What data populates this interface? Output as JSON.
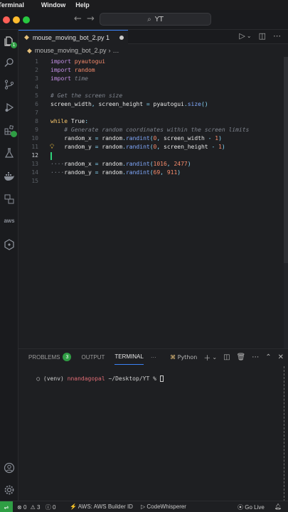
{
  "menubar": {
    "items": [
      "Terminal",
      "Window",
      "Help"
    ]
  },
  "titlebar": {
    "search_text": "YT",
    "search_icon": "search-icon"
  },
  "activity_bar": {
    "icons": [
      "explorer-icon",
      "search-icon",
      "source-control-icon",
      "run-debug-icon",
      "extensions-icon",
      "testing-icon",
      "docker-icon",
      "remote-explorer-icon",
      "aws-icon",
      "codewhisperer-icon",
      "account-icon",
      "settings-icon"
    ],
    "explorer_badge": "1"
  },
  "editor_tab": {
    "label": "mouse_moving_bot_2.py 1"
  },
  "breadcrumb": {
    "file": "mouse_moving_bot_2.py",
    "more": "…"
  },
  "editor": {
    "current_line": "12",
    "lines": [
      {
        "n": "1",
        "parts": [
          [
            "kw",
            "import"
          ],
          [
            "mod",
            " pyautogui"
          ]
        ]
      },
      {
        "n": "2",
        "parts": [
          [
            "kw",
            "import"
          ],
          [
            "mod",
            " random"
          ]
        ]
      },
      {
        "n": "3",
        "parts": [
          [
            "kw",
            "import"
          ],
          [
            "cm",
            " time"
          ]
        ]
      },
      {
        "n": "4",
        "parts": []
      },
      {
        "n": "5",
        "parts": [
          [
            "cm",
            "# Get the screen size"
          ]
        ]
      },
      {
        "n": "6",
        "parts": [
          [
            "vr",
            "screen_width"
          ],
          [
            "op",
            ", "
          ],
          [
            "vr",
            "screen_height"
          ],
          [
            "op",
            " = "
          ],
          [
            "vr",
            "pyautogui"
          ],
          [
            "op",
            "."
          ],
          [
            "fn",
            "size"
          ],
          [
            "op",
            "()"
          ]
        ]
      },
      {
        "n": "7",
        "parts": []
      },
      {
        "n": "8",
        "parts": [
          [
            "kw2",
            "while"
          ],
          [
            "vr",
            " True"
          ],
          [
            "op",
            ":"
          ]
        ]
      },
      {
        "n": "9",
        "parts": [
          [
            "cm",
            "    # Generate random coordinates within the screen limits"
          ]
        ]
      },
      {
        "n": "10",
        "parts": [
          [
            "vr",
            "    random_x"
          ],
          [
            "op",
            " = "
          ],
          [
            "vr",
            "random"
          ],
          [
            "op",
            "."
          ],
          [
            "fn",
            "randint"
          ],
          [
            "op",
            "("
          ],
          [
            "num",
            "0"
          ],
          [
            "op",
            ", "
          ],
          [
            "vr",
            "screen_width"
          ],
          [
            "op",
            " - "
          ],
          [
            "num",
            "1"
          ],
          [
            "op",
            ")"
          ]
        ]
      },
      {
        "n": "11",
        "parts": [
          [
            "vr",
            "    random_y"
          ],
          [
            "op",
            " = "
          ],
          [
            "vr",
            "random"
          ],
          [
            "op",
            "."
          ],
          [
            "fn",
            "randint"
          ],
          [
            "op",
            "("
          ],
          [
            "num",
            "0"
          ],
          [
            "op",
            ", "
          ],
          [
            "vr",
            "screen_height"
          ],
          [
            "op",
            " - "
          ],
          [
            "num",
            "1"
          ],
          [
            "op",
            ")"
          ]
        ]
      },
      {
        "n": "12",
        "parts": []
      },
      {
        "n": "13",
        "parts": [
          [
            "cm",
            "····"
          ],
          [
            "vr",
            "random_x"
          ],
          [
            "op",
            " = "
          ],
          [
            "vr",
            "random"
          ],
          [
            "op",
            "."
          ],
          [
            "fn",
            "randint"
          ],
          [
            "op",
            "("
          ],
          [
            "num",
            "1016"
          ],
          [
            "op",
            ", "
          ],
          [
            "num",
            "2477"
          ],
          [
            "op",
            ")"
          ]
        ]
      },
      {
        "n": "14",
        "parts": [
          [
            "cm",
            "····"
          ],
          [
            "vr",
            "random_y"
          ],
          [
            "op",
            " = "
          ],
          [
            "vr",
            "random"
          ],
          [
            "op",
            "."
          ],
          [
            "fn",
            "randint"
          ],
          [
            "op",
            "("
          ],
          [
            "num",
            "69"
          ],
          [
            "op",
            ", "
          ],
          [
            "num",
            "911"
          ],
          [
            "op",
            ")"
          ]
        ]
      },
      {
        "n": "15",
        "parts": []
      }
    ]
  },
  "panel": {
    "tabs": [
      {
        "label": "PROBLEMS",
        "count": "3",
        "active": false
      },
      {
        "label": "OUTPUT",
        "active": false
      },
      {
        "label": "TERMINAL",
        "active": true
      }
    ],
    "more": "···",
    "terminal_shell": "Python",
    "terminal": {
      "status": "○",
      "venv": "(venv)",
      "user": "nnandagopal",
      "path": "~/Desktop/YT",
      "prompt": "%"
    }
  },
  "statusbar": {
    "remote_icon": "remote-icon",
    "errors": "0",
    "warnings": "3",
    "info": "0",
    "aws": "AWS: AWS Builder ID",
    "codewhisperer": "CodeWhisperer",
    "golive": "Go Live"
  }
}
